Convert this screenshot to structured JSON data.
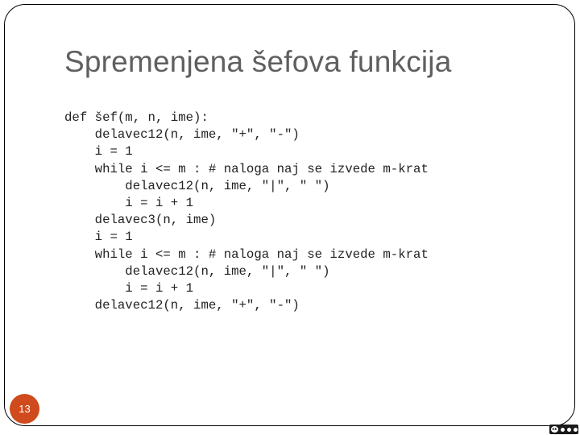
{
  "slide": {
    "title": "Spremenjena šefova funkcija",
    "number": "13",
    "code_lines": [
      "def šef(m, n, ime):",
      "    delavec12(n, ime, \"+\", \"-\")",
      "    i = 1",
      "    while i <= m : # naloga naj se izvede m-krat",
      "        delavec12(n, ime, \"|\", \" \")",
      "        i = i + 1",
      "    delavec3(n, ime)",
      "    i = 1",
      "    while i <= m : # naloga naj se izvede m-krat",
      "        delavec12(n, ime, \"|\", \" \")",
      "        i = i + 1",
      "    delavec12(n, ime, \"+\", \"-\")"
    ],
    "license_badge_icon": "creative-commons-icon",
    "colors": {
      "title": "#5f5f5f",
      "badge": "#cf4a1d",
      "border": "#000000"
    }
  }
}
